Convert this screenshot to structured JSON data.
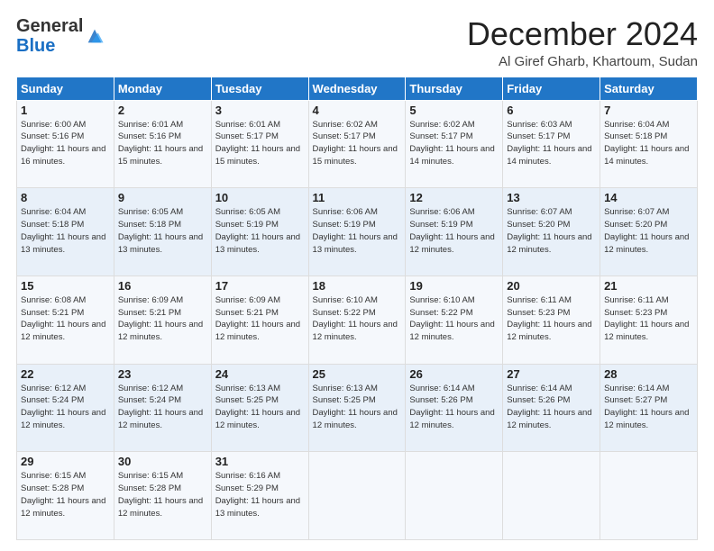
{
  "header": {
    "logo_general": "General",
    "logo_blue": "Blue",
    "month_title": "December 2024",
    "location": "Al Giref Gharb, Khartoum, Sudan"
  },
  "days_of_week": [
    "Sunday",
    "Monday",
    "Tuesday",
    "Wednesday",
    "Thursday",
    "Friday",
    "Saturday"
  ],
  "weeks": [
    [
      {
        "day": 1,
        "sunrise": "6:00 AM",
        "sunset": "5:16 PM",
        "daylight": "11 hours and 16 minutes."
      },
      {
        "day": 2,
        "sunrise": "6:01 AM",
        "sunset": "5:16 PM",
        "daylight": "11 hours and 15 minutes."
      },
      {
        "day": 3,
        "sunrise": "6:01 AM",
        "sunset": "5:17 PM",
        "daylight": "11 hours and 15 minutes."
      },
      {
        "day": 4,
        "sunrise": "6:02 AM",
        "sunset": "5:17 PM",
        "daylight": "11 hours and 15 minutes."
      },
      {
        "day": 5,
        "sunrise": "6:02 AM",
        "sunset": "5:17 PM",
        "daylight": "11 hours and 14 minutes."
      },
      {
        "day": 6,
        "sunrise": "6:03 AM",
        "sunset": "5:17 PM",
        "daylight": "11 hours and 14 minutes."
      },
      {
        "day": 7,
        "sunrise": "6:04 AM",
        "sunset": "5:18 PM",
        "daylight": "11 hours and 14 minutes."
      }
    ],
    [
      {
        "day": 8,
        "sunrise": "6:04 AM",
        "sunset": "5:18 PM",
        "daylight": "11 hours and 13 minutes."
      },
      {
        "day": 9,
        "sunrise": "6:05 AM",
        "sunset": "5:18 PM",
        "daylight": "11 hours and 13 minutes."
      },
      {
        "day": 10,
        "sunrise": "6:05 AM",
        "sunset": "5:19 PM",
        "daylight": "11 hours and 13 minutes."
      },
      {
        "day": 11,
        "sunrise": "6:06 AM",
        "sunset": "5:19 PM",
        "daylight": "11 hours and 13 minutes."
      },
      {
        "day": 12,
        "sunrise": "6:06 AM",
        "sunset": "5:19 PM",
        "daylight": "11 hours and 12 minutes."
      },
      {
        "day": 13,
        "sunrise": "6:07 AM",
        "sunset": "5:20 PM",
        "daylight": "11 hours and 12 minutes."
      },
      {
        "day": 14,
        "sunrise": "6:07 AM",
        "sunset": "5:20 PM",
        "daylight": "11 hours and 12 minutes."
      }
    ],
    [
      {
        "day": 15,
        "sunrise": "6:08 AM",
        "sunset": "5:21 PM",
        "daylight": "11 hours and 12 minutes."
      },
      {
        "day": 16,
        "sunrise": "6:09 AM",
        "sunset": "5:21 PM",
        "daylight": "11 hours and 12 minutes."
      },
      {
        "day": 17,
        "sunrise": "6:09 AM",
        "sunset": "5:21 PM",
        "daylight": "11 hours and 12 minutes."
      },
      {
        "day": 18,
        "sunrise": "6:10 AM",
        "sunset": "5:22 PM",
        "daylight": "11 hours and 12 minutes."
      },
      {
        "day": 19,
        "sunrise": "6:10 AM",
        "sunset": "5:22 PM",
        "daylight": "11 hours and 12 minutes."
      },
      {
        "day": 20,
        "sunrise": "6:11 AM",
        "sunset": "5:23 PM",
        "daylight": "11 hours and 12 minutes."
      },
      {
        "day": 21,
        "sunrise": "6:11 AM",
        "sunset": "5:23 PM",
        "daylight": "11 hours and 12 minutes."
      }
    ],
    [
      {
        "day": 22,
        "sunrise": "6:12 AM",
        "sunset": "5:24 PM",
        "daylight": "11 hours and 12 minutes."
      },
      {
        "day": 23,
        "sunrise": "6:12 AM",
        "sunset": "5:24 PM",
        "daylight": "11 hours and 12 minutes."
      },
      {
        "day": 24,
        "sunrise": "6:13 AM",
        "sunset": "5:25 PM",
        "daylight": "11 hours and 12 minutes."
      },
      {
        "day": 25,
        "sunrise": "6:13 AM",
        "sunset": "5:25 PM",
        "daylight": "11 hours and 12 minutes."
      },
      {
        "day": 26,
        "sunrise": "6:14 AM",
        "sunset": "5:26 PM",
        "daylight": "11 hours and 12 minutes."
      },
      {
        "day": 27,
        "sunrise": "6:14 AM",
        "sunset": "5:26 PM",
        "daylight": "11 hours and 12 minutes."
      },
      {
        "day": 28,
        "sunrise": "6:14 AM",
        "sunset": "5:27 PM",
        "daylight": "11 hours and 12 minutes."
      }
    ],
    [
      {
        "day": 29,
        "sunrise": "6:15 AM",
        "sunset": "5:28 PM",
        "daylight": "11 hours and 12 minutes."
      },
      {
        "day": 30,
        "sunrise": "6:15 AM",
        "sunset": "5:28 PM",
        "daylight": "11 hours and 12 minutes."
      },
      {
        "day": 31,
        "sunrise": "6:16 AM",
        "sunset": "5:29 PM",
        "daylight": "11 hours and 13 minutes."
      },
      null,
      null,
      null,
      null
    ]
  ],
  "labels": {
    "sunrise_prefix": "Sunrise: ",
    "sunset_prefix": "Sunset: ",
    "daylight_prefix": "Daylight: "
  }
}
